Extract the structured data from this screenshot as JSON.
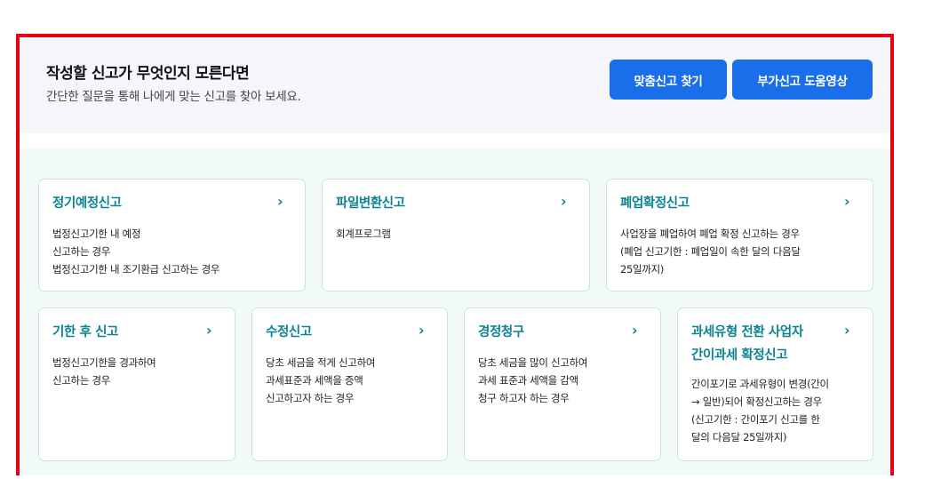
{
  "header": {
    "title": "작성할 신고가 무엇인지 모른다면",
    "subtitle": "간단한 질문을 통해 나에게 맞는 신고를 찾아 보세요.",
    "btn_find": "맞춤신고 찾기",
    "btn_video": "부가신고 도움영상"
  },
  "cards": [
    {
      "title": "정기예정신고",
      "desc": "법정신고기한 내 예정\n신고하는 경우\n법정신고기한 내 조기환급 신고하는 경우",
      "arrow": "›"
    },
    {
      "title": "파일변환신고",
      "desc": "회계프로그램",
      "arrow": "›"
    },
    {
      "title": "폐업확정신고",
      "desc": "사업장을 폐업하여 폐업 확정 신고하는 경우\n(폐업 신고기한 : 폐업일이 속한 달의 다음달\n25일까지)",
      "arrow": "›"
    },
    {
      "title": "기한 후 신고",
      "desc": "법정신고기한을 경과하여\n신고하는 경우",
      "arrow": "›"
    },
    {
      "title": "수정신고",
      "desc": "당초 세금을 적게 신고하여\n과세표준과 세액을 증액\n신고하고자 하는 경우",
      "arrow": "›"
    },
    {
      "title": "경정청구",
      "desc": "당초 세금을 많이 신고하여\n과세 표준과 세액을 감액\n청구 하고자 하는 경우",
      "arrow": "›"
    },
    {
      "title": "과세유형 전환 사업자\n간이과세 확정신고",
      "desc": "간이포기로 과세유형이 변경(간이\n→ 일반)되어 확정신고하는 경우\n(신고기한 : 간이포기 신고를 한\n달의 다음달 25일까지)",
      "arrow": "›"
    }
  ]
}
